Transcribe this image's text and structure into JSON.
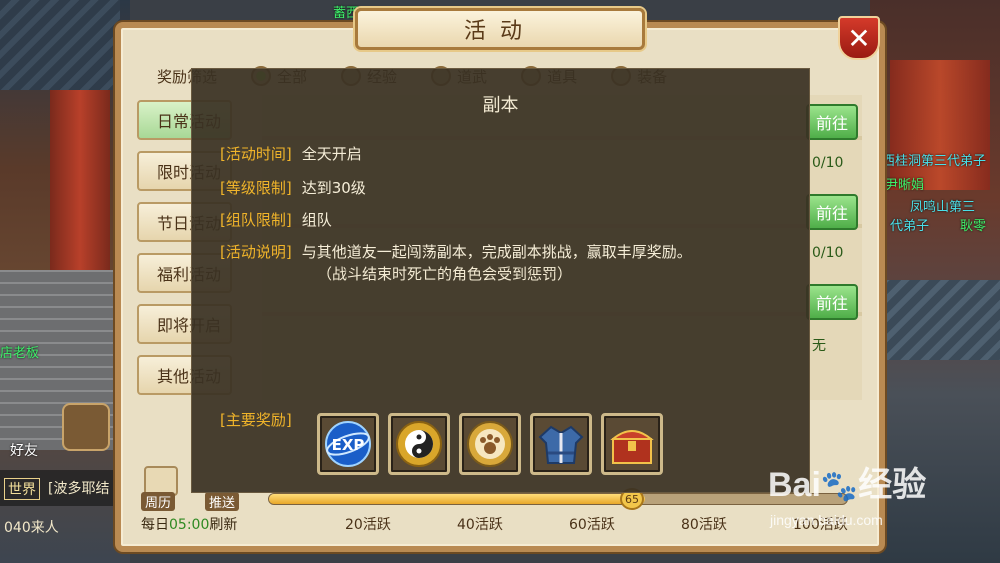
{
  "background": {
    "npc_top": "蓄西",
    "npc_left": "店老板",
    "npc_right_1": "西桂洞第三代弟子",
    "npc_right_2": "尹晰娟",
    "npc_right_3": "凤鸣山第三",
    "npc_right_4": "代弟子",
    "npc_right_5": "耿零"
  },
  "panel": {
    "title": "活动",
    "close_label": "✕",
    "filter_label": "奖励筛选",
    "filters": [
      "全部",
      "经验",
      "道武",
      "道具",
      "装备"
    ],
    "side_tabs": [
      "日常活动",
      "限时活动",
      "节日活动",
      "福利活动",
      "即将开启",
      "其他活动"
    ],
    "go_buttons": [
      "前往",
      "前往",
      "前往"
    ],
    "counts": [
      "0/10",
      "0/10",
      "无"
    ]
  },
  "bottom": {
    "friend_label": "好友",
    "chat_channel": "世界",
    "chat_message": "[波多耶结",
    "online": "040来人",
    "calendar_label": "周历",
    "push_label": "推送",
    "daily_prefix": "每日",
    "daily_time": "05:00",
    "daily_suffix": "刷新",
    "progress_value": "65",
    "milestones": [
      "20活跃",
      "40活跃",
      "60活跃",
      "80活跃",
      "100活跃"
    ]
  },
  "modal": {
    "title": "副本",
    "rows": [
      {
        "label": "[活动时间]",
        "value": "全天开启"
      },
      {
        "label": "[等级限制]",
        "value": "达到30级"
      },
      {
        "label": "[组队限制]",
        "value": "组队"
      },
      {
        "label": "[活动说明]",
        "value": "与其他道友一起闯荡副本，完成副本挑战，赢取丰厚奖励。"
      }
    ],
    "note": "（战斗结束时死亡的角色会受到惩罚）",
    "reward_label": "[主要奖励]",
    "rewards": [
      "exp-icon",
      "yin-yang-icon",
      "paw-badge-icon",
      "robe-icon",
      "treasure-chest-icon"
    ]
  },
  "watermark": {
    "brand": "Bai",
    "brand2": "经验",
    "url": "jingyan.baidu.com"
  }
}
